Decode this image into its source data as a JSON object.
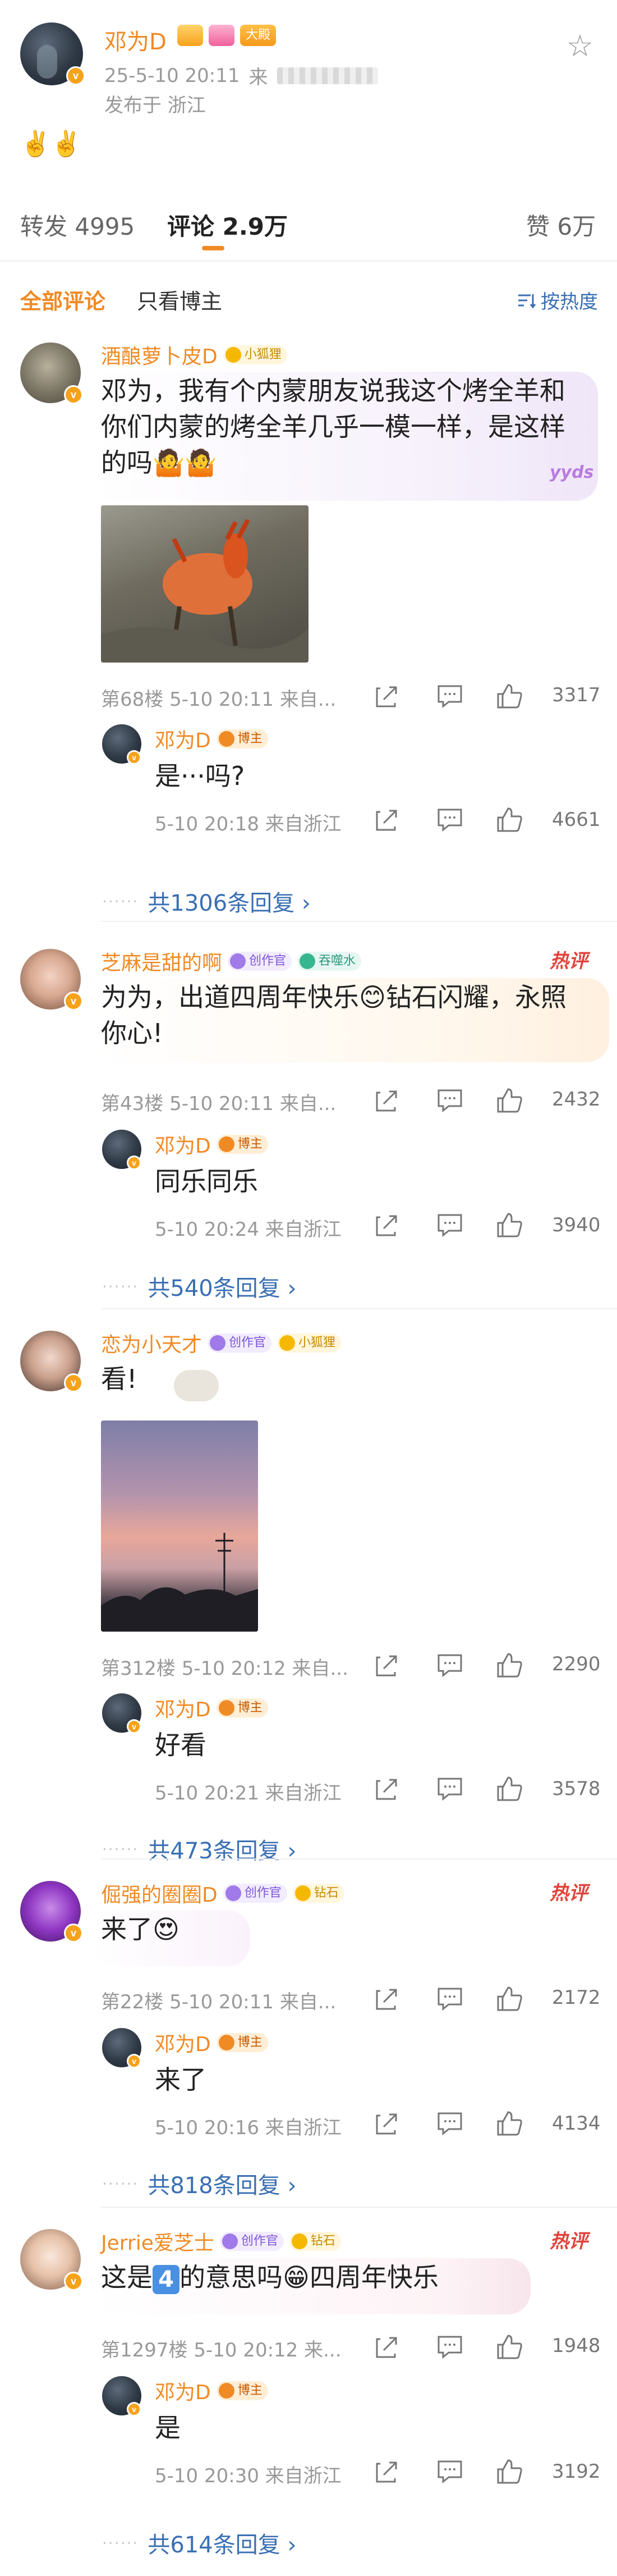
{
  "post": {
    "author": "邓为D",
    "badge_big": "大殿",
    "date": "25-5-10 20:11",
    "date_suffix": "来",
    "location": "发布于 浙江",
    "emoji": "✌️✌️"
  },
  "stats": {
    "repost": "转发 4995",
    "comments": "评论 2.9万",
    "likes": "赞 6万"
  },
  "filters": {
    "all": "全部评论",
    "author_only": "只看博主",
    "sort": "按热度"
  },
  "reply_author": "邓为D",
  "reply_tag": "博主",
  "comments": [
    {
      "name": "酒酿萝卜皮D",
      "tags": [
        "小狐狸"
      ],
      "text": "邓为，我有个内蒙朋友说我这个烤全羊和你们内蒙的烤全羊几乎一模一样，是这样的吗🤷🤷",
      "sticker": "yyds",
      "meta": "第68楼  5-10 20:11  来自...",
      "likes": "3317",
      "reply_text": "是···吗?",
      "reply_meta": "5-10 20:18  来自浙江",
      "reply_likes": "4661",
      "more": "共1306条回复 ›"
    },
    {
      "name": "芝麻是甜的啊",
      "tags": [
        "创作官",
        "吞噬水"
      ],
      "hot": "热评",
      "text": "为为，出道四周年快乐😊钻石闪耀，永照你心!",
      "meta": "第43楼  5-10 20:11  来自...",
      "likes": "2432",
      "reply_text": "同乐同乐",
      "reply_meta": "5-10 20:24  来自浙江",
      "reply_likes": "3940",
      "more": "共540条回复 ›"
    },
    {
      "name": "恋为小天才",
      "tags": [
        "创作官",
        "小狐狸"
      ],
      "text": "看!",
      "meta": "第312楼  5-10 20:12  来自...",
      "likes": "2290",
      "reply_text": "好看",
      "reply_meta": "5-10 20:21  来自浙江",
      "reply_likes": "3578",
      "more": "共473条回复 ›"
    },
    {
      "name": "倔强的圈圈D",
      "tags": [
        "创作官",
        "钻石"
      ],
      "hot": "热评",
      "text": "来了😍",
      "meta": "第22楼  5-10 20:11  来自...",
      "likes": "2172",
      "reply_text": "来了",
      "reply_meta": "5-10 20:16  来自浙江",
      "reply_likes": "4134",
      "more": "共818条回复 ›"
    },
    {
      "name": "Jerrie爱芝士",
      "tags": [
        "创作官",
        "钻石"
      ],
      "hot": "热评",
      "text_before": "这是",
      "text_num": "4",
      "text_after": "的意思吗😁四周年快乐",
      "meta": "第1297楼  5-10 20:12  来...",
      "likes": "1948",
      "reply_text": "是",
      "reply_meta": "5-10 20:30  来自浙江",
      "reply_likes": "3192",
      "more": "共614条回复 ›"
    }
  ],
  "colors": {
    "accent": "#f08a24",
    "link": "#3a6fb3",
    "hot": "#e0443b"
  }
}
